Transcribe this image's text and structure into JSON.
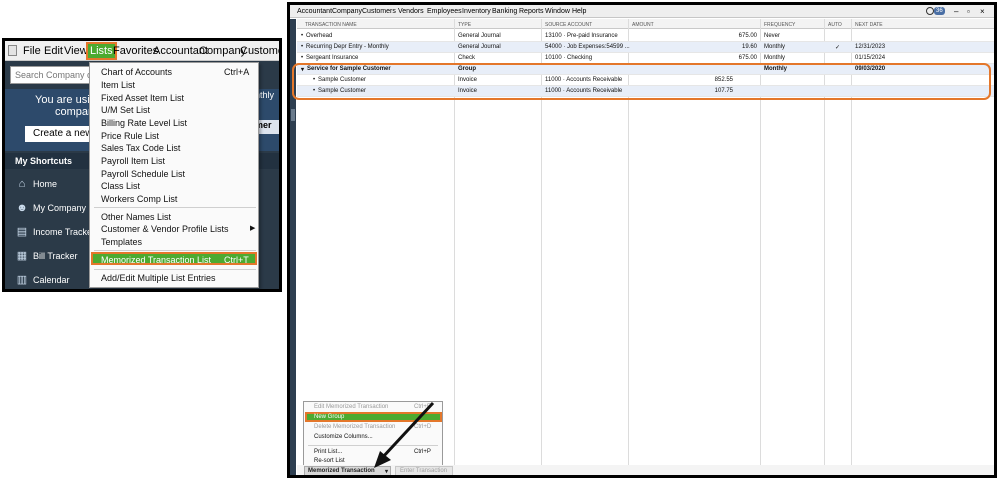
{
  "left_panel": {
    "menubar": {
      "items": [
        "File",
        "Edit",
        "View",
        "Lists",
        "Favorites",
        "Accountant",
        "Company",
        "Customers"
      ]
    },
    "search_placeholder": "Search Company or",
    "you_are_using": "You are using",
    "company_fragment": "compan",
    "create_button": "Create a new c",
    "my_shortcuts": "My Shortcuts",
    "shortcuts": [
      {
        "label": "Home",
        "icon": "home-icon"
      },
      {
        "label": "My Company",
        "icon": "people-icon"
      },
      {
        "label": "Income Tracker",
        "icon": "income-icon"
      },
      {
        "label": "Bill Tracker",
        "icon": "bill-icon"
      },
      {
        "label": "Calendar",
        "icon": "calendar-icon"
      }
    ],
    "right_fragments": [
      "nthly",
      "mer"
    ],
    "lists_menu": {
      "items": [
        {
          "label": "Chart of Accounts",
          "shortcut": "Ctrl+A"
        },
        {
          "label": "Item List",
          "shortcut": ""
        },
        {
          "label": "Fixed Asset Item List",
          "shortcut": ""
        },
        {
          "label": "U/M Set List",
          "shortcut": ""
        },
        {
          "label": "Billing Rate Level List",
          "shortcut": ""
        },
        {
          "label": "Price Rule List",
          "shortcut": ""
        },
        {
          "label": "Sales Tax Code List",
          "shortcut": ""
        },
        {
          "label": "Payroll Item List",
          "shortcut": ""
        },
        {
          "label": "Payroll Schedule List",
          "shortcut": ""
        },
        {
          "label": "Class List",
          "shortcut": ""
        },
        {
          "label": "Workers Comp List",
          "shortcut": ""
        },
        {
          "label": "Other Names List",
          "shortcut": ""
        },
        {
          "label": "Customer & Vendor Profile Lists",
          "shortcut": ""
        },
        {
          "label": "Templates",
          "shortcut": ""
        },
        {
          "label": "Memorized Transaction List",
          "shortcut": "Ctrl+T"
        },
        {
          "label": "Add/Edit Multiple List Entries",
          "shortcut": ""
        }
      ]
    }
  },
  "right_window": {
    "menubar": {
      "items": [
        "Accountant",
        "Company",
        "Customers",
        "Vendors",
        "Employees",
        "Inventory",
        "Banking",
        "Reports",
        "Window",
        "Help"
      ],
      "badge": "36"
    },
    "columns": [
      "TRANSACTION NAME",
      "TYPE",
      "SOURCE ACCOUNT",
      "AMOUNT",
      "FREQUENCY",
      "AUTO",
      "NEXT DATE"
    ],
    "rows": [
      {
        "name": "Overhead",
        "type": "General Journal",
        "account": "13100 · Pre-paid Insurance",
        "amount": "675.00",
        "frequency": "Never",
        "auto": "",
        "next": ""
      },
      {
        "name": "Recurring  Depr Entry - Monthly",
        "type": "General Journal",
        "account": "54000 · Job Expenses:54599 ...",
        "amount": "19.60",
        "frequency": "Monthly",
        "auto": "✓",
        "next": "12/31/2023"
      },
      {
        "name": "Sergeant Insurance",
        "type": "Check",
        "account": "10100 · Checking",
        "amount": "675.00",
        "frequency": "Monthly",
        "auto": "",
        "next": "01/15/2024"
      },
      {
        "name": "Service for Sample Customer",
        "type": "Group",
        "account": "",
        "amount": "",
        "frequency": "Monthly",
        "auto": "",
        "next": "09/03/2020"
      },
      {
        "name": "Sample Customer",
        "type": "Invoice",
        "account": "11000 · Accounts Receivable",
        "amount": "852.55",
        "frequency": "",
        "auto": "",
        "next": ""
      },
      {
        "name": "Sample Customer",
        "type": "Invoice",
        "account": "11000 · Accounts Receivable",
        "amount": "107.75",
        "frequency": "",
        "auto": "",
        "next": ""
      }
    ],
    "context_menu": {
      "items": [
        {
          "label": "Edit Memorized Transaction",
          "shortcut": "Ctrl+E"
        },
        {
          "label": "New Group",
          "shortcut": ""
        },
        {
          "label": "Delete Memorized Transaction",
          "shortcut": "Ctrl+D"
        },
        {
          "label": "Customize Columns...",
          "shortcut": ""
        },
        {
          "label": "Print List...",
          "shortcut": "Ctrl+P"
        },
        {
          "label": "Re-sort List",
          "shortcut": ""
        }
      ]
    },
    "buttons": {
      "memorized_transaction": "Memorized Transaction",
      "dropdown_caret": "▾",
      "enter_transaction": "Enter Transaction"
    }
  },
  "colors": {
    "highlight_green": "#4caa30",
    "annotation_orange": "#e4772b",
    "left_sidebar": "#2b3a48"
  }
}
